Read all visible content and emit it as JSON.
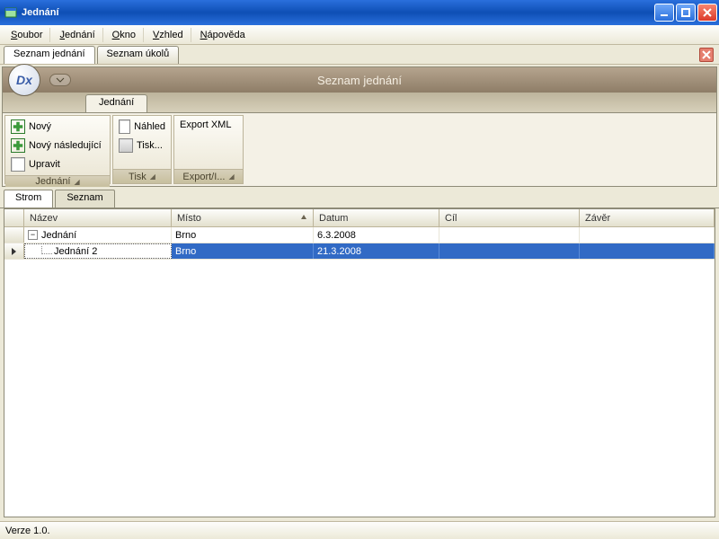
{
  "window": {
    "title": "Jednání"
  },
  "menubar": [
    {
      "label": "Soubor",
      "u": "S"
    },
    {
      "label": "Jednání",
      "u": "J"
    },
    {
      "label": "Okno",
      "u": "O"
    },
    {
      "label": "Vzhled",
      "u": "V"
    },
    {
      "label": "Nápověda",
      "u": "N"
    }
  ],
  "docTabs": [
    {
      "label": "Seznam jednání",
      "active": true
    },
    {
      "label": "Seznam úkolů",
      "active": false
    }
  ],
  "ribbon": {
    "logoText": "Dx",
    "title": "Seznam jednání",
    "activeTab": "Jednání",
    "groups": {
      "meeting": {
        "label": "Jednání",
        "new": "Nový",
        "newNext": "Nový následující",
        "edit": "Upravit"
      },
      "print": {
        "label": "Tisk",
        "preview": "Náhled",
        "print": "Tisk..."
      },
      "export": {
        "label": "Export/I...",
        "exportXml": "Export XML"
      }
    }
  },
  "viewTabs": [
    {
      "label": "Strom",
      "active": true
    },
    {
      "label": "Seznam",
      "active": false
    }
  ],
  "grid": {
    "columns": {
      "nazev": "Název",
      "misto": "Místo",
      "datum": "Datum",
      "cil": "Cíl",
      "zaver": "Závěr"
    },
    "rows": [
      {
        "nazev": "Jednání",
        "misto": "Brno",
        "datum": "6.3.2008",
        "cil": "",
        "zaver": "",
        "level": 0,
        "expanded": true,
        "selected": false
      },
      {
        "nazev": "Jednání 2",
        "misto": "Brno",
        "datum": "21.3.2008",
        "cil": "",
        "zaver": "",
        "level": 1,
        "expanded": false,
        "selected": true
      }
    ]
  },
  "status": {
    "version": "Verze 1.0."
  }
}
